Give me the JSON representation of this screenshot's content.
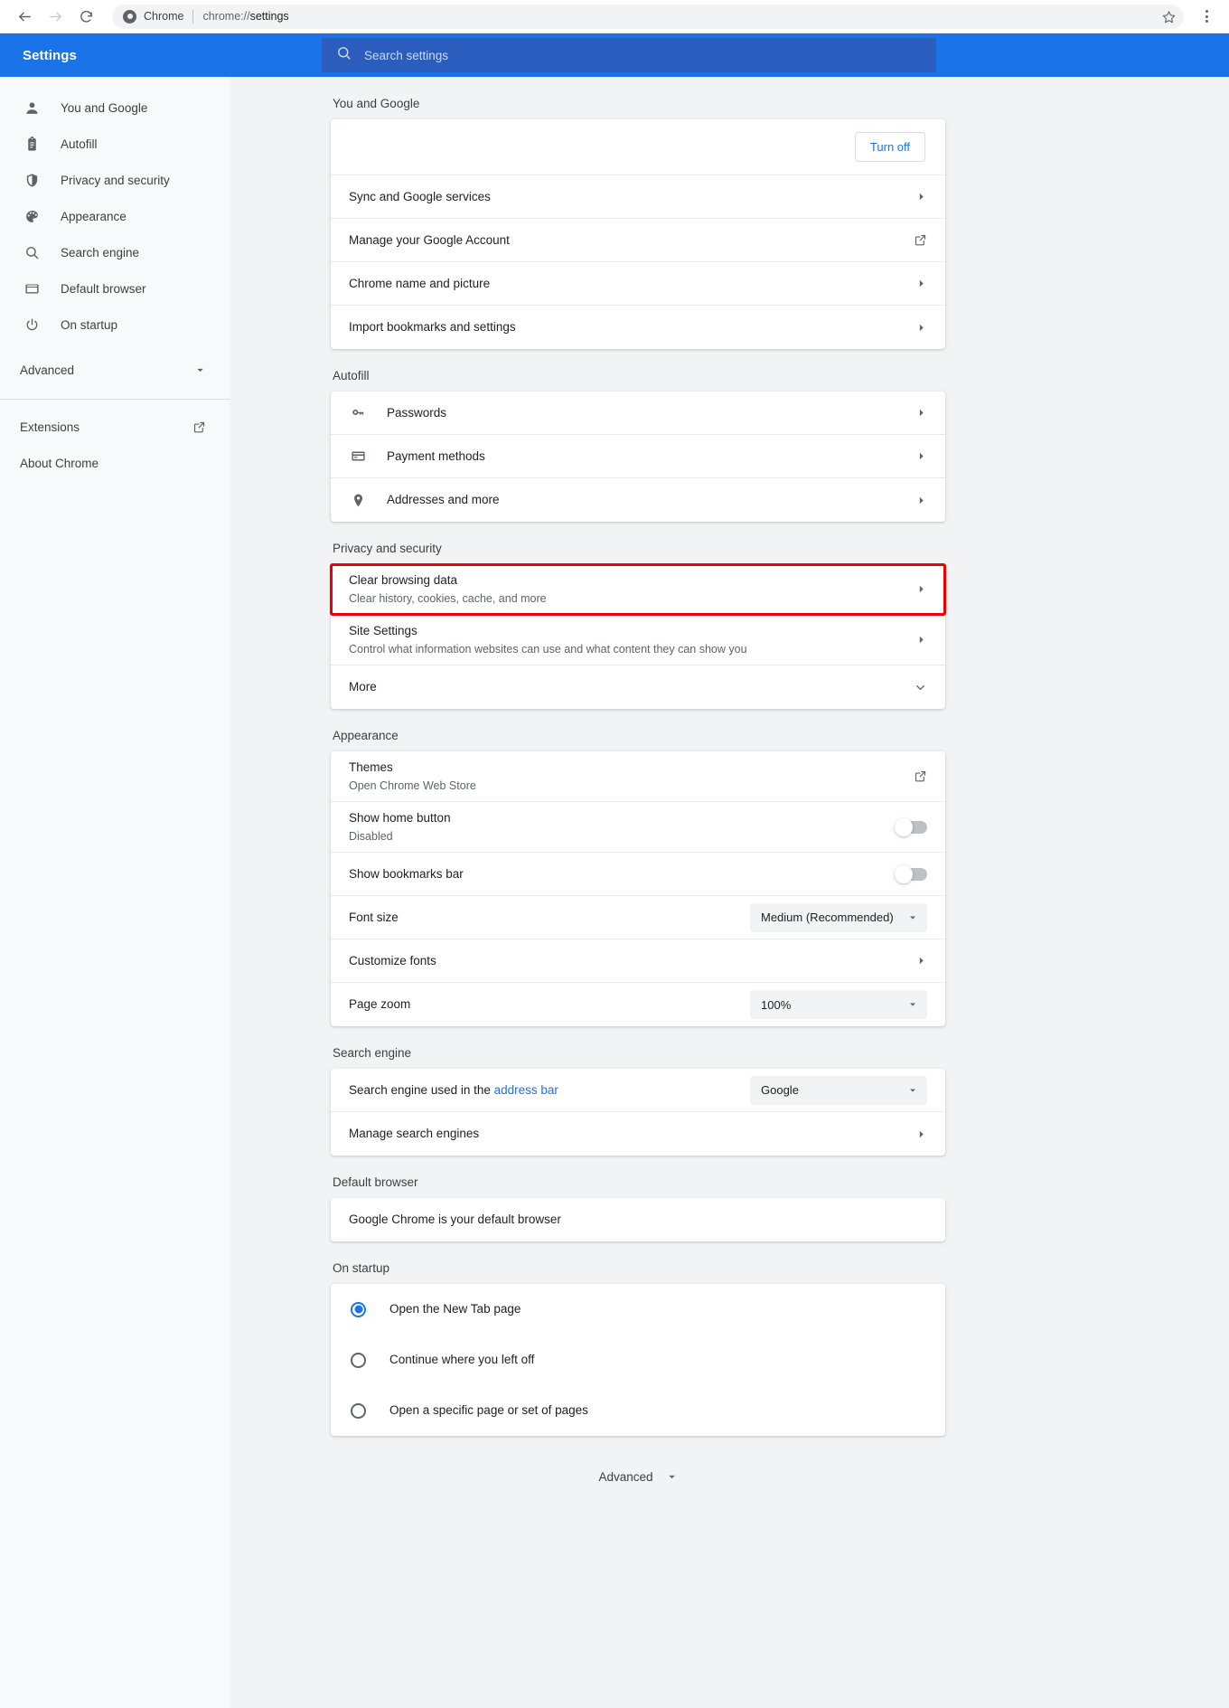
{
  "browser": {
    "back_icon": "back-arrow-icon",
    "forward_icon": "forward-arrow-icon",
    "reload_icon": "reload-icon",
    "chip_label": "Chrome",
    "url": "chrome://settings",
    "url_scheme": "chrome://",
    "url_path": "settings",
    "star_icon": "bookmark-star-icon",
    "menu_icon": "three-dot-menu-icon"
  },
  "header": {
    "title": "Settings",
    "search_placeholder": "Search settings",
    "search_value": "",
    "accent_color": "#1a73e8"
  },
  "sidebar": {
    "items": [
      {
        "label": "You and Google",
        "icon": "person-icon"
      },
      {
        "label": "Autofill",
        "icon": "clipboard-icon"
      },
      {
        "label": "Privacy and security",
        "icon": "shield-icon"
      },
      {
        "label": "Appearance",
        "icon": "palette-icon"
      },
      {
        "label": "Search engine",
        "icon": "search-icon"
      },
      {
        "label": "Default browser",
        "icon": "browser-window-icon"
      },
      {
        "label": "On startup",
        "icon": "power-icon"
      }
    ],
    "advanced_label": "Advanced",
    "extensions_label": "Extensions",
    "about_label": "About Chrome"
  },
  "sections": {
    "you_and_google": {
      "title": "You and Google",
      "turn_off_label": "Turn off",
      "rows": [
        {
          "label": "Sync and Google services",
          "action": "chevron-right"
        },
        {
          "label": "Manage your Google Account",
          "action": "external-link"
        },
        {
          "label": "Chrome name and picture",
          "action": "chevron-right"
        },
        {
          "label": "Import bookmarks and settings",
          "action": "chevron-right"
        }
      ]
    },
    "autofill": {
      "title": "Autofill",
      "rows": [
        {
          "label": "Passwords",
          "icon": "key-icon",
          "action": "chevron-right"
        },
        {
          "label": "Payment methods",
          "icon": "credit-card-icon",
          "action": "chevron-right"
        },
        {
          "label": "Addresses and more",
          "icon": "location-pin-icon",
          "action": "chevron-right"
        }
      ]
    },
    "privacy": {
      "title": "Privacy and security",
      "rows": [
        {
          "label": "Clear browsing data",
          "sub": "Clear history, cookies, cache, and more",
          "action": "chevron-right",
          "highlighted": true,
          "highlight_color": "#ee0000"
        },
        {
          "label": "Site Settings",
          "sub": "Control what information websites can use and what content they can show you",
          "action": "chevron-right",
          "highlighted": false
        },
        {
          "label": "More",
          "sub": "",
          "action": "chevron-down",
          "highlighted": false
        }
      ]
    },
    "appearance": {
      "title": "Appearance",
      "themes_label": "Themes",
      "themes_sub": "Open Chrome Web Store",
      "home_button_label": "Show home button",
      "home_button_sub": "Disabled",
      "home_button_state": "off",
      "bookmarks_bar_label": "Show bookmarks bar",
      "bookmarks_bar_state": "off",
      "font_size_label": "Font size",
      "font_size_value": "Medium (Recommended)",
      "customize_fonts_label": "Customize fonts",
      "page_zoom_label": "Page zoom",
      "page_zoom_value": "100%"
    },
    "search_engine": {
      "title": "Search engine",
      "used_label_prefix": "Search engine used in the ",
      "used_label_link": "address bar",
      "used_value": "Google",
      "manage_label": "Manage search engines"
    },
    "default_browser": {
      "title": "Default browser",
      "status": "Google Chrome is your default browser"
    },
    "on_startup": {
      "title": "On startup",
      "options": [
        {
          "label": "Open the New Tab page",
          "selected": true
        },
        {
          "label": "Continue where you left off",
          "selected": false
        },
        {
          "label": "Open a specific page or set of pages",
          "selected": false
        }
      ]
    }
  },
  "footer": {
    "advanced_label": "Advanced",
    "caret_icon": "chevron-down-icon"
  }
}
